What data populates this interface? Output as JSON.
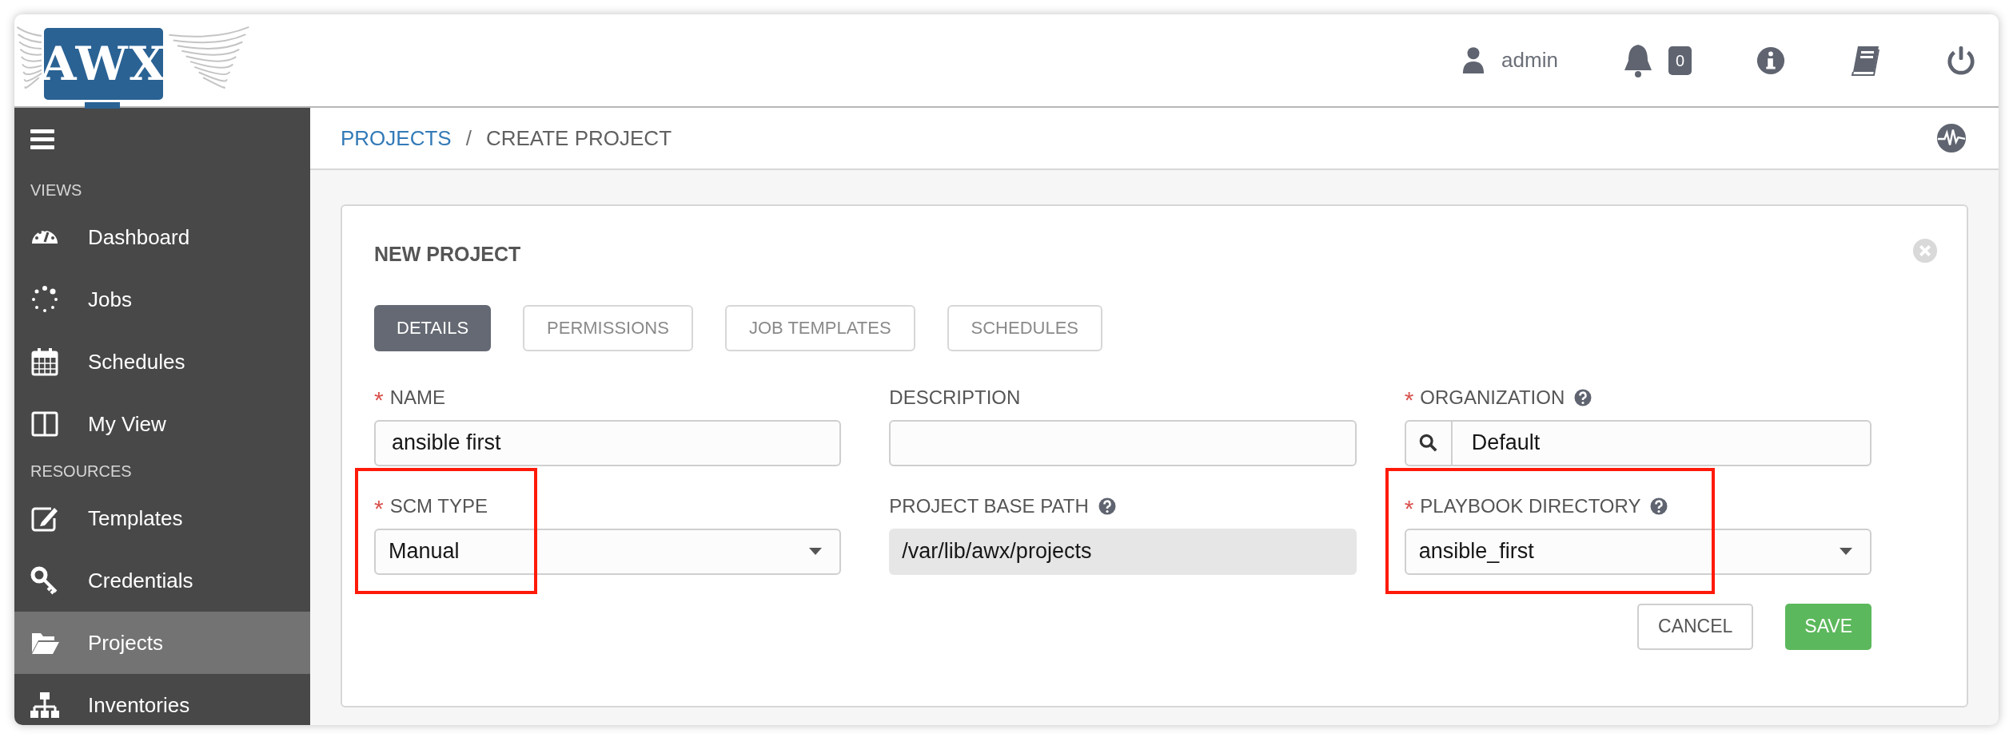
{
  "header": {
    "logo_text": "AWX",
    "user": "admin",
    "notification_count": "0"
  },
  "sidebar": {
    "sections": [
      {
        "title": "VIEWS",
        "items": [
          {
            "label": "Dashboard",
            "selected": false
          },
          {
            "label": "Jobs",
            "selected": false
          },
          {
            "label": "Schedules",
            "selected": false
          },
          {
            "label": "My View",
            "selected": false
          }
        ]
      },
      {
        "title": "RESOURCES",
        "items": [
          {
            "label": "Templates",
            "selected": false
          },
          {
            "label": "Credentials",
            "selected": false
          },
          {
            "label": "Projects",
            "selected": true
          },
          {
            "label": "Inventories",
            "selected": false
          }
        ]
      }
    ]
  },
  "breadcrumb": {
    "separator": "/",
    "items": [
      {
        "label": "PROJECTS",
        "kind": "link"
      },
      {
        "label": "CREATE PROJECT",
        "kind": "current"
      }
    ]
  },
  "form": {
    "title": "NEW PROJECT",
    "required_mark": "*",
    "tabs": [
      {
        "label": "DETAILS",
        "selected": true
      },
      {
        "label": "PERMISSIONS",
        "selected": false
      },
      {
        "label": "JOB TEMPLATES",
        "selected": false
      },
      {
        "label": "SCHEDULES",
        "selected": false
      }
    ],
    "fields": [
      {
        "label": "NAME",
        "kind": "text",
        "required": true,
        "help": false,
        "highlighted": false,
        "value": "ansible first"
      },
      {
        "label": "DESCRIPTION",
        "kind": "text",
        "required": false,
        "help": false,
        "highlighted": false
      },
      {
        "label": "ORGANIZATION",
        "kind": "lookup",
        "required": true,
        "help": true,
        "highlighted": false,
        "value": "Default"
      },
      {
        "label": "SCM TYPE",
        "kind": "select",
        "required": true,
        "help": false,
        "highlighted": true,
        "value": "Manual"
      },
      {
        "label": "PROJECT BASE PATH",
        "kind": "readonly",
        "required": false,
        "help": true,
        "highlighted": false,
        "value": "/var/lib/awx/projects"
      },
      {
        "label": "PLAYBOOK DIRECTORY",
        "kind": "select",
        "required": true,
        "help": true,
        "highlighted": true,
        "value": "ansible_first"
      }
    ],
    "buttons": [
      {
        "label": "CANCEL",
        "kind": "secondary"
      },
      {
        "label": "SAVE",
        "kind": "primary"
      }
    ]
  }
}
